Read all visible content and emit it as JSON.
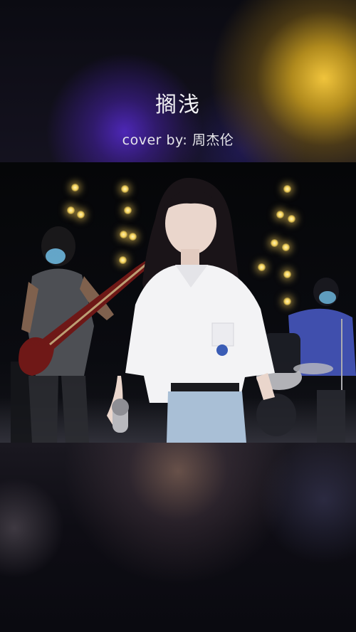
{
  "video_title": "搁浅",
  "cover_credit": "cover by:  周杰伦"
}
